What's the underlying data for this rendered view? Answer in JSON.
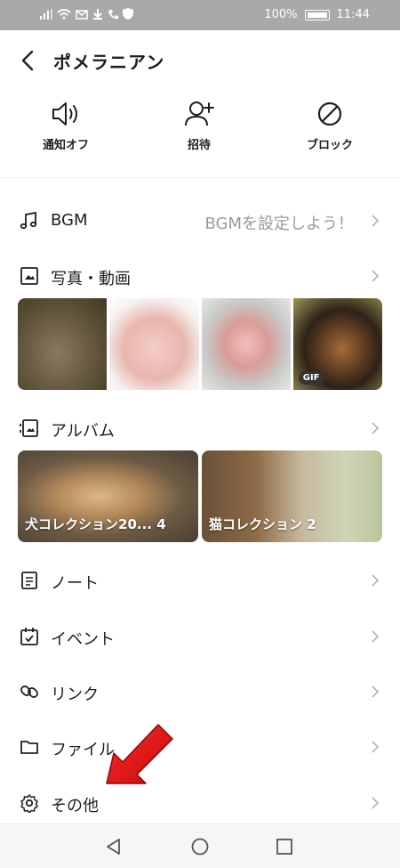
{
  "status_bar": {
    "battery": "100%",
    "time": "11:44"
  },
  "header": {
    "title": "ポメラニアン"
  },
  "actions": [
    {
      "label": "通知オフ",
      "icon": "speaker-icon"
    },
    {
      "label": "招待",
      "icon": "add-person-icon"
    },
    {
      "label": "ブロック",
      "icon": "block-icon"
    }
  ],
  "rows": {
    "bgm": {
      "label": "BGM",
      "hint": "BGMを設定しよう！"
    },
    "photos": {
      "label": "写真・動画"
    },
    "album": {
      "label": "アルバム"
    },
    "note": {
      "label": "ノート"
    },
    "event": {
      "label": "イベント"
    },
    "link": {
      "label": "リンク"
    },
    "file": {
      "label": "ファイル"
    },
    "other": {
      "label": "その他"
    }
  },
  "photo_strip": {
    "gif_badge": "GIF"
  },
  "albums": [
    {
      "name": "犬コレクション20...",
      "count": "4"
    },
    {
      "name": "猫コレクション",
      "count": "2"
    }
  ],
  "colors": {
    "accent_arrow": "#e01212",
    "status_bar": "#a9a9a9"
  }
}
